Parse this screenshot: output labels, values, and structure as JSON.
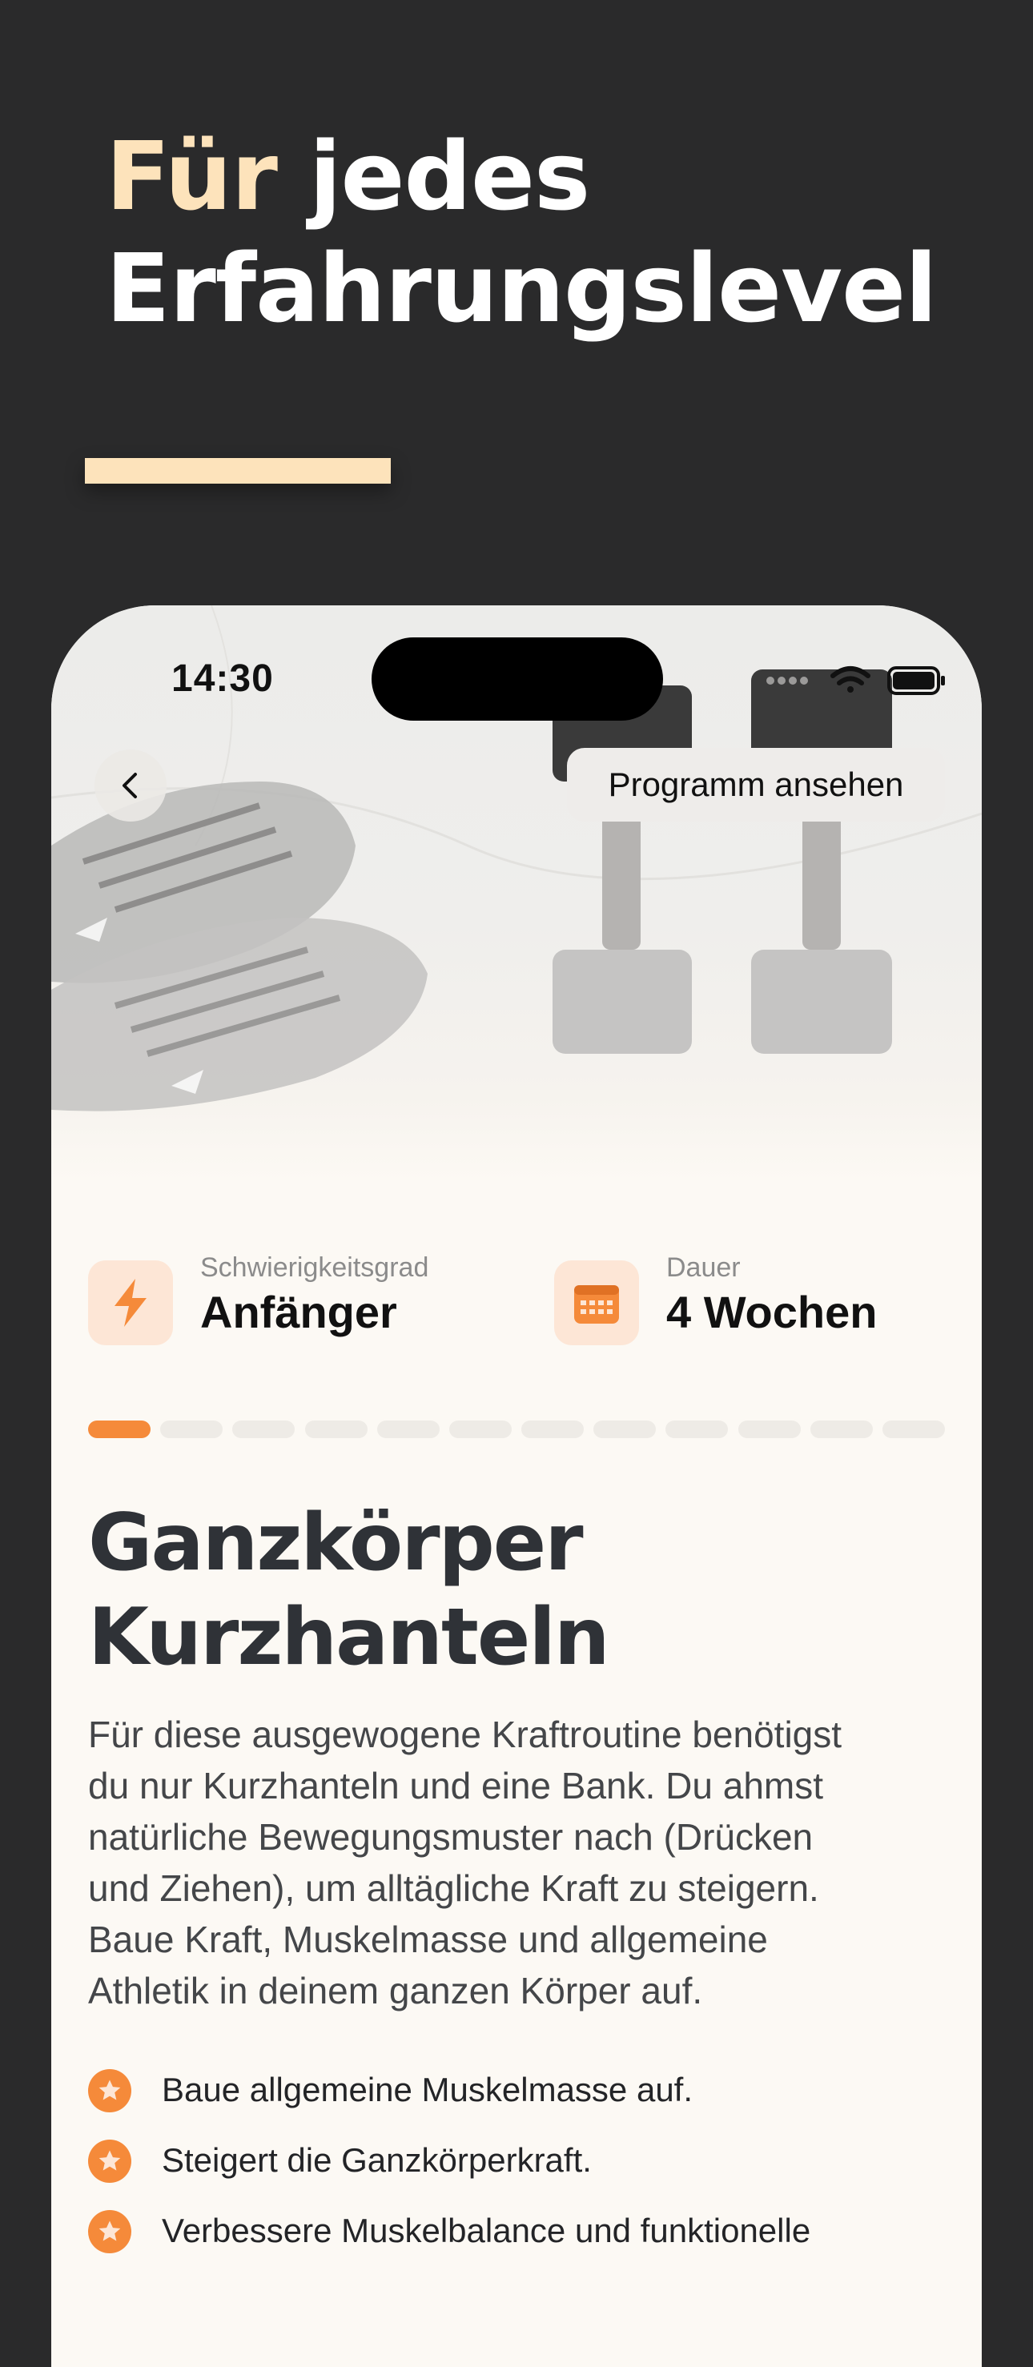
{
  "headline": {
    "accent": "Für",
    "rest_line1": "jedes",
    "line2": "Erfahrungslevel"
  },
  "status_bar": {
    "time": "14:30"
  },
  "hero": {
    "back_icon": "chevron-left-icon",
    "program_button": "Programm ansehen"
  },
  "meta": {
    "difficulty": {
      "icon": "lightning-icon",
      "label": "Schwierigkeitsgrad",
      "value": "Anfänger"
    },
    "duration": {
      "icon": "calendar-icon",
      "label": "Dauer",
      "value": "4 Wochen"
    }
  },
  "progress": {
    "current": 1,
    "total": 12
  },
  "program": {
    "title_line1": "Ganzkörper",
    "title_line2": "Kurzhanteln",
    "description": [
      "Für diese ausgewogene Kraftroutine benötigst",
      "du nur Kurzhanteln und eine Bank. Du ahmst",
      "natürliche Bewegungsmuster nach (Drücken",
      "und Ziehen), um alltägliche Kraft zu steigern.",
      "Baue Kraft, Muskelmasse und allgemeine",
      "Athletik in deinem ganzen Körper auf."
    ],
    "benefits": [
      "Baue allgemeine Muskelmasse auf.",
      "Steigert die Ganzkörperkraft.",
      "Verbessere Muskelbalance und funktionelle"
    ]
  },
  "colors": {
    "accent": "#f58a3a",
    "headline_accent": "#fde3bb",
    "background": "#2a2a2b",
    "card": "#fcf9f4"
  }
}
